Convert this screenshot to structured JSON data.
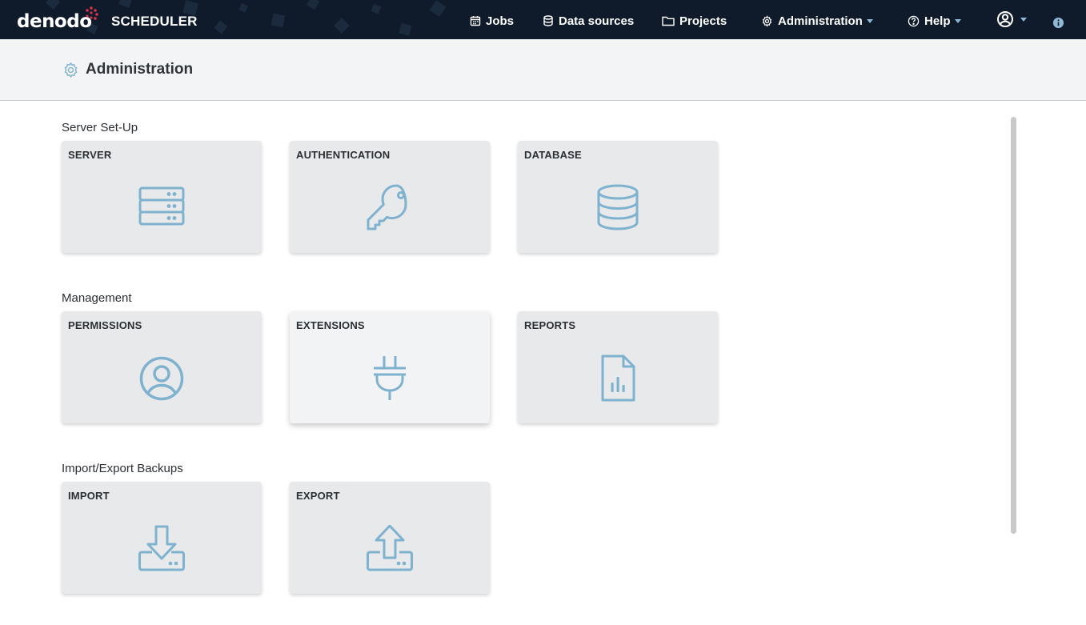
{
  "brand": {
    "name": "denodo",
    "product": "SCHEDULER"
  },
  "nav": {
    "jobs": "Jobs",
    "data_sources": "Data sources",
    "projects": "Projects",
    "administration": "Administration",
    "help": "Help"
  },
  "page": {
    "title": "Administration"
  },
  "sections": [
    {
      "title": "Server Set-Up",
      "cards": [
        {
          "label": "SERVER",
          "icon": "server-icon"
        },
        {
          "label": "AUTHENTICATION",
          "icon": "key-icon"
        },
        {
          "label": "DATABASE",
          "icon": "database-icon"
        }
      ]
    },
    {
      "title": "Management",
      "cards": [
        {
          "label": "PERMISSIONS",
          "icon": "user-circle-icon"
        },
        {
          "label": "EXTENSIONS",
          "icon": "plug-icon"
        },
        {
          "label": "REPORTS",
          "icon": "report-file-icon"
        }
      ]
    },
    {
      "title": "Import/Export Backups",
      "cards": [
        {
          "label": "IMPORT",
          "icon": "import-icon"
        },
        {
          "label": "EXPORT",
          "icon": "export-icon"
        }
      ]
    }
  ],
  "colors": {
    "topbar": "#0f1b2a",
    "icon": "#7fb2cf",
    "card": "#e8e9ea",
    "brand_dots": "#e2314b"
  }
}
